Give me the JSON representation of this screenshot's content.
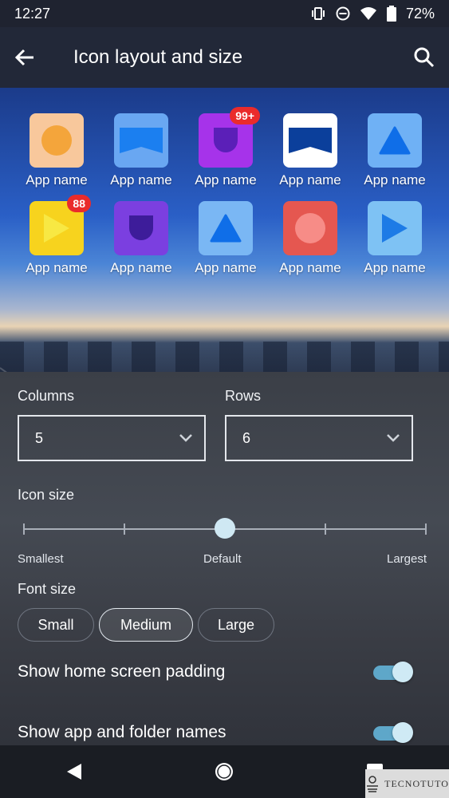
{
  "status_bar": {
    "time": "12:27",
    "battery": "72%",
    "icons": [
      "vibrate-icon",
      "do-not-disturb-icon",
      "wifi-icon",
      "battery-icon"
    ]
  },
  "app_bar": {
    "title": "Icon layout and size",
    "back_icon": "arrow-left-icon",
    "search_icon": "search-icon"
  },
  "preview": {
    "apps": [
      {
        "label": "App name",
        "bg": "#f8c89c",
        "shape": "circle",
        "fg": "#f4a53b",
        "badge": ""
      },
      {
        "label": "App name",
        "bg": "#69a7f2",
        "shape": "ribbon",
        "fg": "#1b7ff0",
        "badge": ""
      },
      {
        "label": "App name",
        "bg": "#a633ea",
        "shape": "shield",
        "fg": "#5b1fb8",
        "badge": "99+"
      },
      {
        "label": "App name",
        "bg": "#ffffff",
        "shape": "ribbon",
        "fg": "#0b3f9b",
        "badge": ""
      },
      {
        "label": "App name",
        "bg": "#6fb1f5",
        "shape": "triangle",
        "fg": "#0f6ee8",
        "badge": ""
      },
      {
        "label": "App name",
        "bg": "#f7d31e",
        "shape": "play",
        "fg": "#f8e843",
        "badge": "88"
      },
      {
        "label": "App name",
        "bg": "#7b3fe0",
        "shape": "shield",
        "fg": "#3d1c9a",
        "badge": ""
      },
      {
        "label": "App name",
        "bg": "#7ab7f4",
        "shape": "triangle",
        "fg": "#0f6ee8",
        "badge": ""
      },
      {
        "label": "App name",
        "bg": "#e55750",
        "shape": "circle",
        "fg": "#f78c87",
        "badge": ""
      },
      {
        "label": "App name",
        "bg": "#7ec2f4",
        "shape": "play",
        "fg": "#1d7be6",
        "badge": ""
      }
    ]
  },
  "settings": {
    "columns_label": "Columns",
    "columns_value": "5",
    "rows_label": "Rows",
    "rows_value": "6",
    "icon_size_label": "Icon size",
    "icon_size_level": 0.5,
    "slider_steps": 5,
    "slider_labels": {
      "min": "Smallest",
      "mid": "Default",
      "max": "Largest"
    },
    "font_size_label": "Font size",
    "font_options": [
      "Small",
      "Medium",
      "Large"
    ],
    "font_selected": "Medium",
    "padding_label": "Show home screen padding",
    "padding_on": true,
    "names_label": "Show app and folder names",
    "names_on": true
  },
  "nav": {
    "icons": [
      "back-triangle-icon",
      "home-circle-icon",
      "recents-square-icon"
    ]
  },
  "watermark": {
    "text": "TECNOTUTO"
  }
}
